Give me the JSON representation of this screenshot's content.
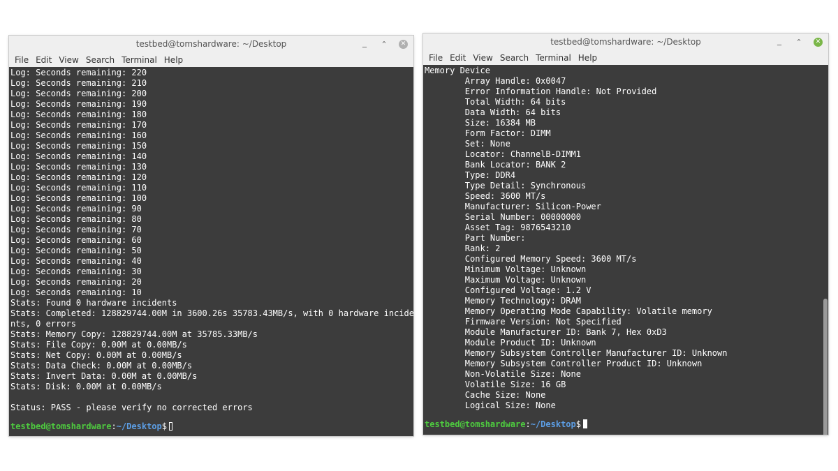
{
  "left_window": {
    "title": "testbed@tomshardware: ~/Desktop",
    "menu": [
      "File",
      "Edit",
      "View",
      "Search",
      "Terminal",
      "Help"
    ],
    "lines": [
      "Log: Seconds remaining: 220",
      "Log: Seconds remaining: 210",
      "Log: Seconds remaining: 200",
      "Log: Seconds remaining: 190",
      "Log: Seconds remaining: 180",
      "Log: Seconds remaining: 170",
      "Log: Seconds remaining: 160",
      "Log: Seconds remaining: 150",
      "Log: Seconds remaining: 140",
      "Log: Seconds remaining: 130",
      "Log: Seconds remaining: 120",
      "Log: Seconds remaining: 110",
      "Log: Seconds remaining: 100",
      "Log: Seconds remaining: 90",
      "Log: Seconds remaining: 80",
      "Log: Seconds remaining: 70",
      "Log: Seconds remaining: 60",
      "Log: Seconds remaining: 50",
      "Log: Seconds remaining: 40",
      "Log: Seconds remaining: 30",
      "Log: Seconds remaining: 20",
      "Log: Seconds remaining: 10",
      "Stats: Found 0 hardware incidents",
      "Stats: Completed: 128829744.00M in 3600.26s 35783.43MB/s, with 0 hardware incide",
      "nts, 0 errors",
      "Stats: Memory Copy: 128829744.00M at 35785.33MB/s",
      "Stats: File Copy: 0.00M at 0.00MB/s",
      "Stats: Net Copy: 0.00M at 0.00MB/s",
      "Stats: Data Check: 0.00M at 0.00MB/s",
      "Stats: Invert Data: 0.00M at 0.00MB/s",
      "Stats: Disk: 0.00M at 0.00MB/s",
      "",
      "Status: PASS - please verify no corrected errors"
    ],
    "prompt": {
      "user_host": "testbed@tomshardware",
      "colon": ":",
      "path": "~/Desktop",
      "dollar": "$"
    }
  },
  "right_window": {
    "title": "testbed@tomshardware: ~/Desktop",
    "menu": [
      "File",
      "Edit",
      "View",
      "Search",
      "Terminal",
      "Help"
    ],
    "lines": [
      "Memory Device",
      "\tArray Handle: 0x0047",
      "\tError Information Handle: Not Provided",
      "\tTotal Width: 64 bits",
      "\tData Width: 64 bits",
      "\tSize: 16384 MB",
      "\tForm Factor: DIMM",
      "\tSet: None",
      "\tLocator: ChannelB-DIMM1",
      "\tBank Locator: BANK 2",
      "\tType: DDR4",
      "\tType Detail: Synchronous",
      "\tSpeed: 3600 MT/s",
      "\tManufacturer: Silicon-Power",
      "\tSerial Number: 00000000",
      "\tAsset Tag: 9876543210",
      "\tPart Number: ",
      "\tRank: 2",
      "\tConfigured Memory Speed: 3600 MT/s",
      "\tMinimum Voltage: Unknown",
      "\tMaximum Voltage: Unknown",
      "\tConfigured Voltage: 1.2 V",
      "\tMemory Technology: DRAM",
      "\tMemory Operating Mode Capability: Volatile memory",
      "\tFirmware Version: Not Specified",
      "\tModule Manufacturer ID: Bank 7, Hex 0xD3",
      "\tModule Product ID: Unknown",
      "\tMemory Subsystem Controller Manufacturer ID: Unknown",
      "\tMemory Subsystem Controller Product ID: Unknown",
      "\tNon-Volatile Size: None",
      "\tVolatile Size: 16 GB",
      "\tCache Size: None",
      "\tLogical Size: None"
    ],
    "prompt": {
      "user_host": "testbed@tomshardware",
      "colon": ":",
      "path": "~/Desktop",
      "dollar": "$"
    }
  },
  "colors": {
    "terminal_bg": "#3c3c3c",
    "prompt_user": "#4ecb3f",
    "prompt_path": "#5c9ee5",
    "titlebar_bg": "#efefef"
  }
}
